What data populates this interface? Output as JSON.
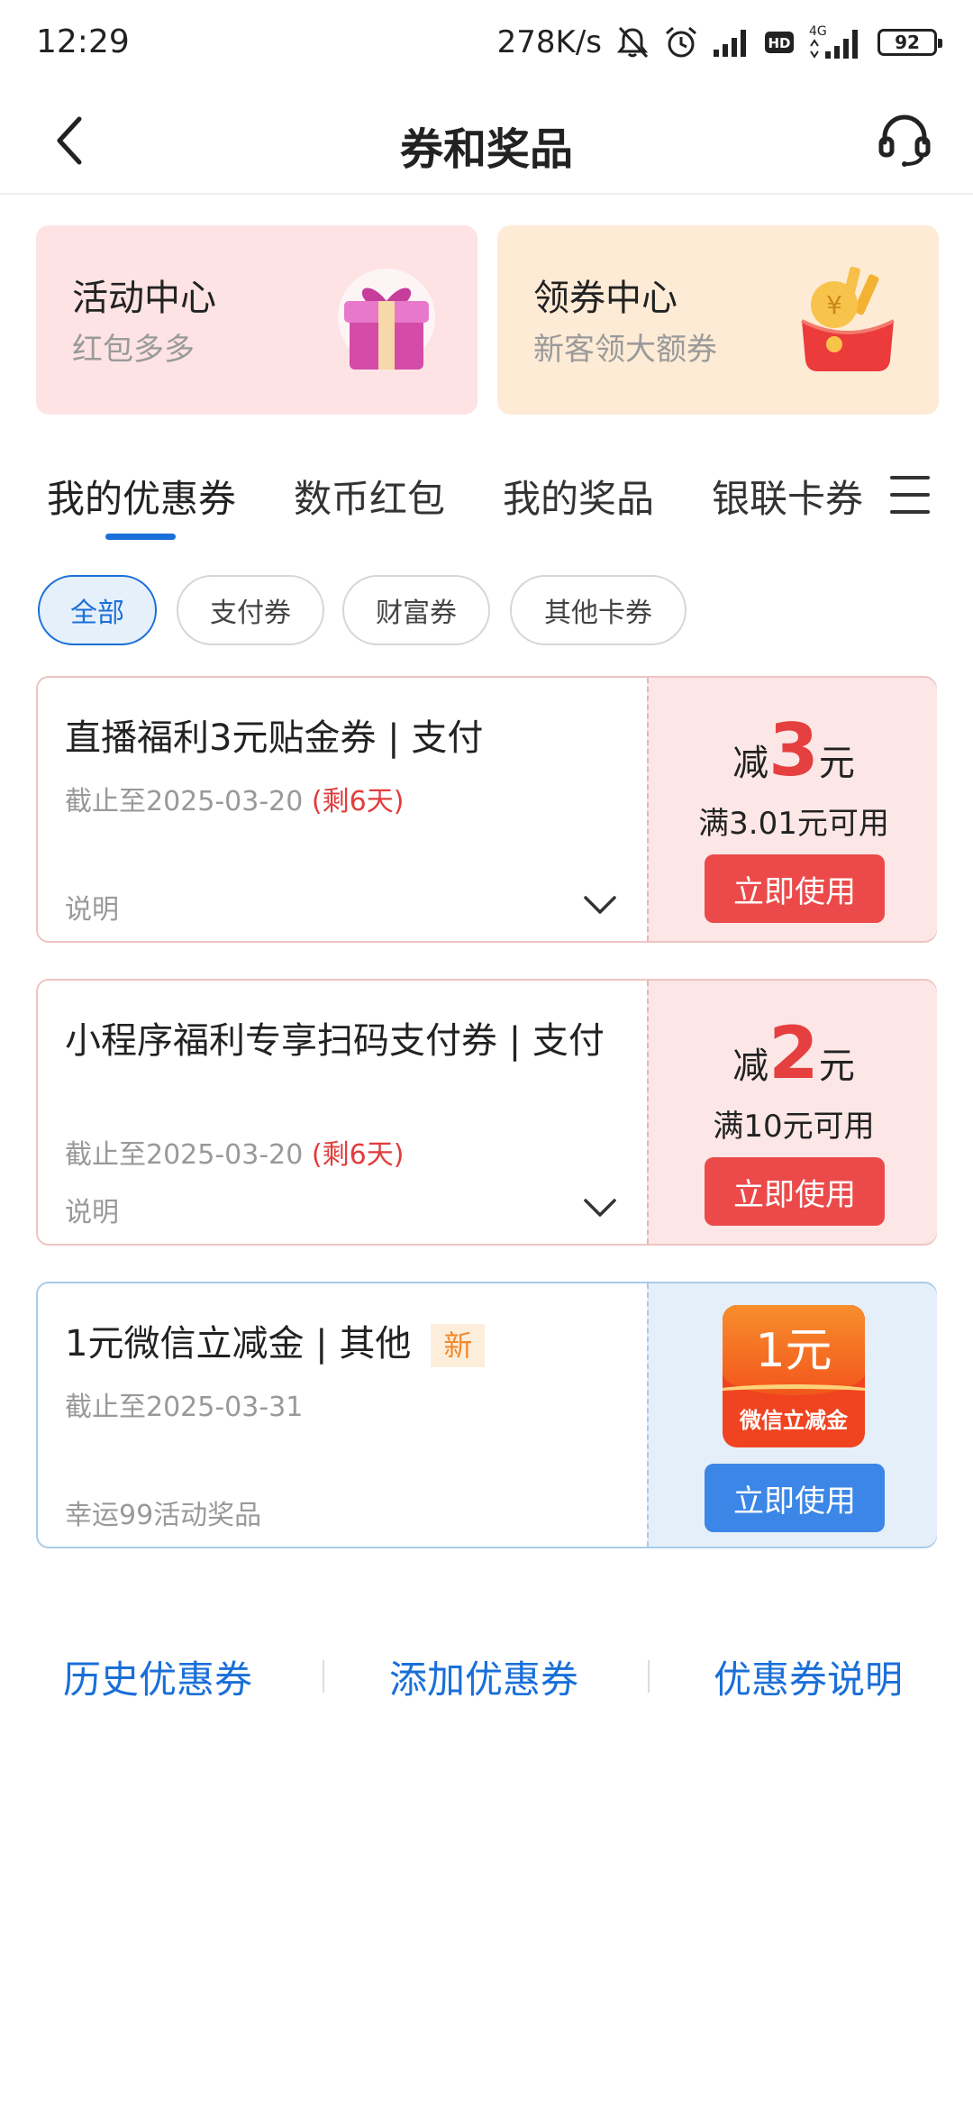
{
  "status_bar": {
    "time": "12:29",
    "net_speed": "278K/s",
    "network_type": "4G",
    "hd_label": "HD",
    "battery": "92",
    "icons": [
      "mute-icon",
      "alarm-icon",
      "signal-icon",
      "hd-icon",
      "signal-4g-icon",
      "battery-icon"
    ]
  },
  "nav": {
    "title": "券和奖品",
    "back_icon": "chevron-left-icon",
    "service_icon": "headset-icon"
  },
  "promo_cards": [
    {
      "title": "活动中心",
      "subtitle": "红包多多",
      "icon": "gift-box-icon",
      "bg": "#fde3e4"
    },
    {
      "title": "领券中心",
      "subtitle": "新客领大额券",
      "icon": "red-envelope-icon",
      "bg": "#fdebd6"
    }
  ],
  "tabs": [
    "我的优惠券",
    "数币红包",
    "我的奖品",
    "银联卡券"
  ],
  "active_tab": "我的优惠券",
  "filters": [
    "全部",
    "支付券",
    "财富券",
    "其他卡券"
  ],
  "active_filter": "全部",
  "coupons": [
    {
      "title": "直播福利3元贴金券 | 支付",
      "date": "截止至2025-03-20",
      "remain": "(剩6天)",
      "note": "说明",
      "prefix": "减",
      "amount": "3",
      "suffix": "元",
      "condition": "满3.01元可用",
      "button": "立即使用"
    },
    {
      "title": "小程序福利专享扫码支付券 | 支付",
      "date": "截止至2025-03-20",
      "remain": "(剩6天)",
      "note": "说明",
      "prefix": "减",
      "amount": "2",
      "suffix": "元",
      "condition": "满10元可用",
      "button": "立即使用"
    },
    {
      "title": "1元微信立减金 | 其他",
      "badge": "新",
      "date": "截止至2025-03-31",
      "note": "幸运99活动奖品",
      "badge_amount": "1元",
      "badge_name": "微信立减金",
      "button": "立即使用"
    }
  ],
  "footer": {
    "history": "历史优惠券",
    "add": "添加优惠券",
    "explain": "优惠券说明"
  },
  "colors": {
    "accent": "#1a6fd8",
    "red": "#ec4a4a",
    "amount_red": "#e53f3f",
    "use_blue": "#3b86e6"
  }
}
